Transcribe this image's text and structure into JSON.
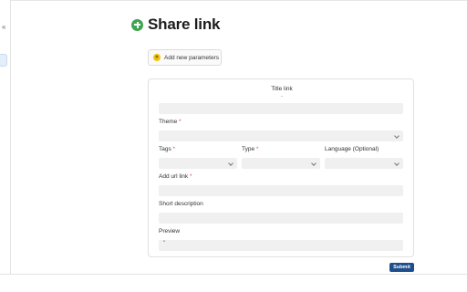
{
  "sidebar": {
    "collapse_glyph": "«"
  },
  "header": {
    "title": "Share link",
    "icon": "plus-circle-icon"
  },
  "toolbar": {
    "add_params_label": "Add new parameters",
    "add_params_icon": "star-icon"
  },
  "form": {
    "title_link_label": "Title link",
    "title_link_mark": "-",
    "required_mark": "*",
    "theme_label": "Theme",
    "tags_label": "Tags",
    "type_label": "Type",
    "language_label": "Language (Optional)",
    "url_label": "Add url link",
    "short_description_label": "Short description",
    "preview_label": "Preview",
    "preview_value": "\""
  },
  "actions": {
    "submit_label": "Submit"
  },
  "colors": {
    "accent": "#1f4e8c",
    "icon_green": "#3da550",
    "required": "#d9534f",
    "field_bg": "#f0f0f0"
  }
}
